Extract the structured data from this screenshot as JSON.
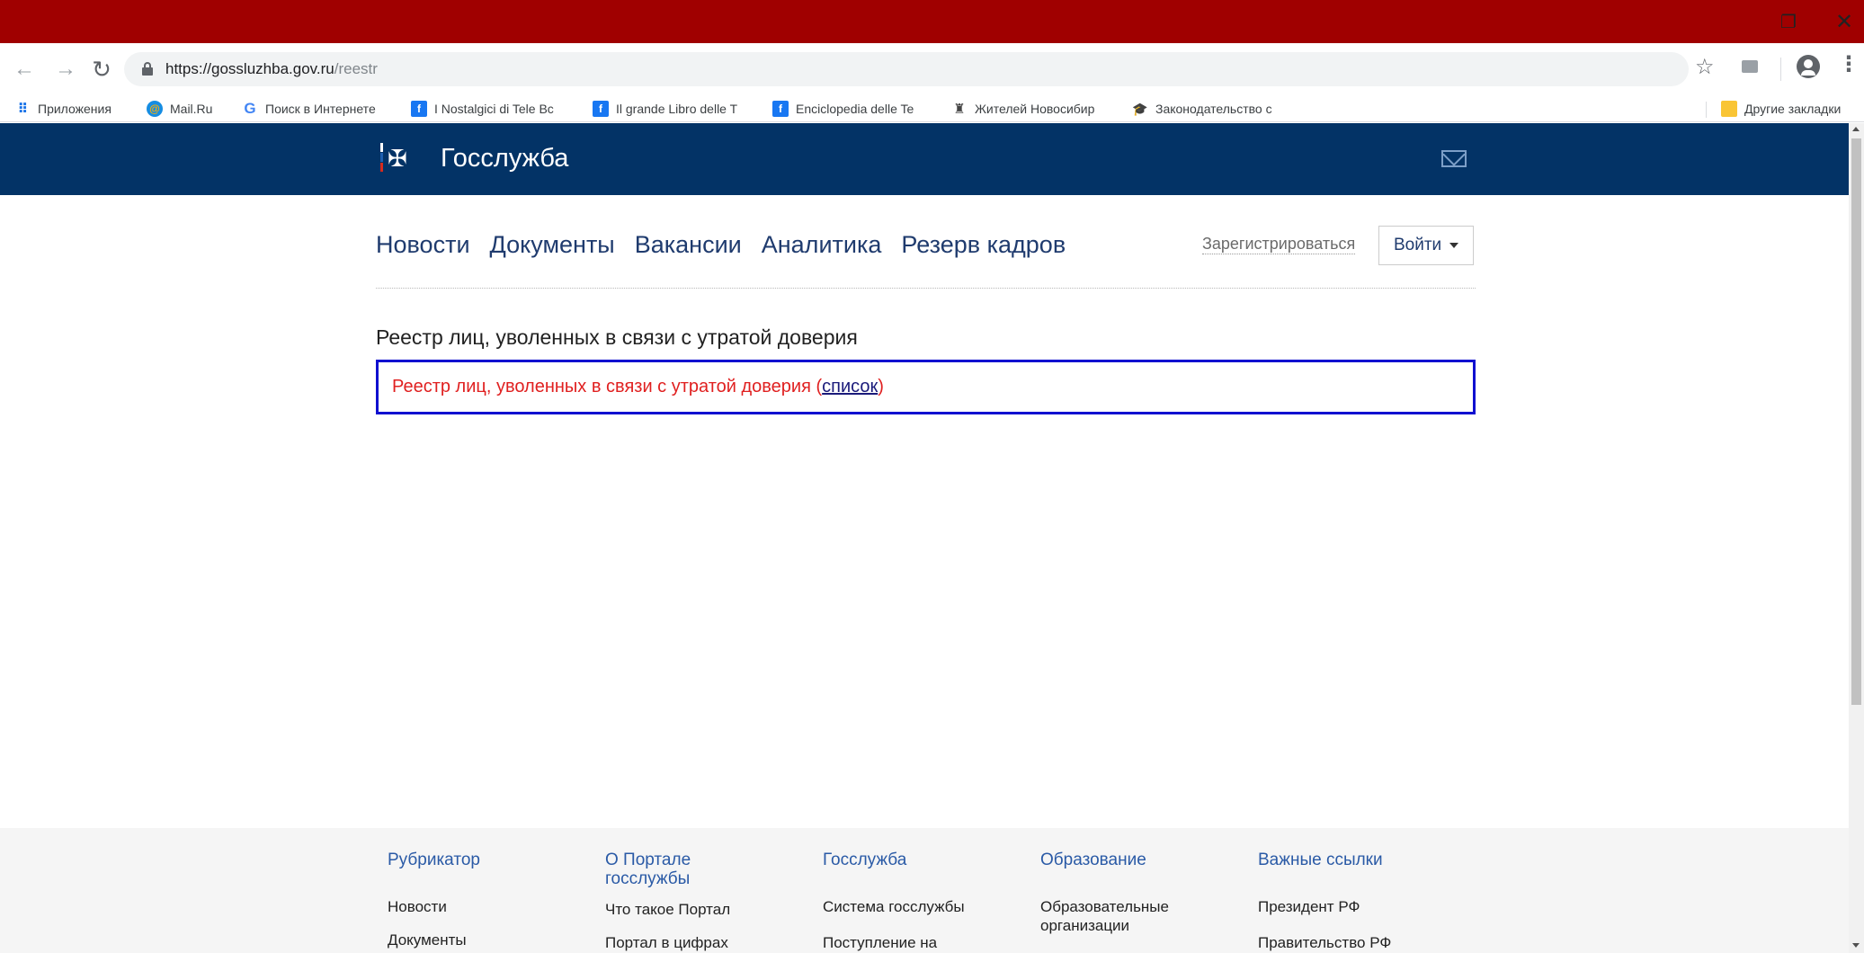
{
  "browser": {
    "url_host": "https://gossluzhba.gov.ru",
    "url_path": "/reestr"
  },
  "bookmarks": [
    {
      "label": "Приложения",
      "icon": "apps-grid-icon"
    },
    {
      "label": "Mail.Ru",
      "icon": "mailru-icon"
    },
    {
      "label": "Поиск в Интернете",
      "icon": "google-icon"
    },
    {
      "label": "I Nostalgici di Tele Bc",
      "icon": "facebook-icon"
    },
    {
      "label": "Il grande Libro delle T",
      "icon": "facebook-icon"
    },
    {
      "label": "Enciclopedia delle Te",
      "icon": "facebook-icon"
    },
    {
      "label": "Жителей Новосибир",
      "icon": "novosibirsk-icon"
    },
    {
      "label": "Законодательство с",
      "icon": "graduation-cap-icon"
    },
    {
      "label": "Другие закладки",
      "icon": "folder-icon"
    }
  ],
  "site": {
    "title": "Госслужба",
    "nav": [
      "Новости",
      "Документы",
      "Вакансии",
      "Аналитика",
      "Резерв кадров"
    ],
    "register_label": "Зарегистрироваться",
    "login_label": "Войти"
  },
  "main": {
    "heading": "Реестр лиц, уволенных в связи с утратой доверия",
    "box_text": "Реестр лиц, уволенных в связи с утратой доверия (",
    "box_link": "список",
    "box_close": ")"
  },
  "footer": {
    "columns": [
      {
        "heading": "Рубрикатор",
        "items": [
          "Новости",
          "Документы"
        ]
      },
      {
        "heading": "О Портале госслужбы",
        "items": [
          "Что такое Портал",
          "Портал в цифрах"
        ]
      },
      {
        "heading": "Госслужба",
        "items": [
          "Система госслужбы",
          "Поступление на"
        ]
      },
      {
        "heading": "Образование",
        "items": [
          "Образовательные организации"
        ]
      },
      {
        "heading": "Важные ссылки",
        "items": [
          "Президент РФ",
          "Правительство РФ"
        ]
      }
    ]
  },
  "colors": {
    "titlebar": "#a00000",
    "site_header": "#033366",
    "nav_link": "#1f3b6e",
    "registry_box_border": "#1010d0",
    "registry_text": "#e02020",
    "footer_heading": "#2a5aa6"
  }
}
